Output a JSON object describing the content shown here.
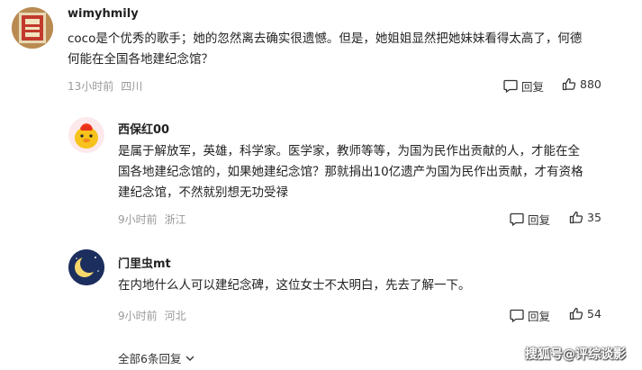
{
  "comments": [
    {
      "username": "wimyhmily",
      "text_line1": "coco是个优秀的歌手；她的忽然离去确实很遗憾。但是，她姐姐显然把她妹妹看得太高了，何德",
      "text_line2": "何能在全国各地建纪念馆？",
      "time": "13小时前",
      "location": "四川",
      "reply_label": "回复",
      "likes": "880"
    },
    {
      "username": "西保红00",
      "text_line1": "是属于解放军，英雄，科学家。医学家，教师等等，为国为民作出贡献的人，才能在全",
      "text_line2": "国各地建纪念馆的，如果她建纪念馆？那就捐出10亿遗产为国为民作出贡献，才有资格",
      "text_line3": "建纪念馆，不然就别想无功受禄",
      "time": "9小时前",
      "location": "浙江",
      "reply_label": "回复",
      "likes": "35"
    },
    {
      "username": "门里虫mt",
      "text_line1": "在内地什么人可以建纪念碑，这位女士不太明白，先去了解一下。",
      "time": "9小时前",
      "location": "河北",
      "reply_label": "回复",
      "likes": "54"
    }
  ],
  "more_replies_label": "全部6条回复",
  "watermark": "搜狐号@评综谈影",
  "icons": {
    "reply": "comment-bubble-icon",
    "like": "thumbs-up-icon",
    "expand": "chevron-down-icon"
  }
}
